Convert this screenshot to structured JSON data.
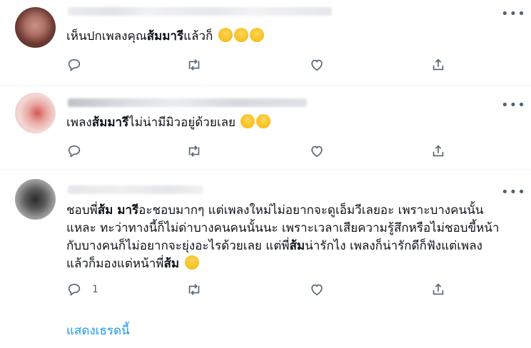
{
  "tweets": [
    {
      "text_plain1": "เห็นปกเพลงคุณ",
      "text_bold1": "ส้มมารี",
      "text_plain2": "แล้วก็",
      "emojis": [
        "crying-face-emoji",
        "crying-face-emoji",
        "crying-face-emoji"
      ],
      "reply_count": "",
      "retweet_count": "",
      "like_count": ""
    },
    {
      "text_plain1": "เพลง",
      "text_bold1": "ส้มมารี",
      "text_plain2": "ไม่น่ามีมิวอยู่ด้วยเลย",
      "emojis": [
        "unamused-face-emoji",
        "unamused-face-emoji"
      ],
      "reply_count": "",
      "retweet_count": "",
      "like_count": ""
    },
    {
      "line1_plain1": "ชอบพี่",
      "line1_bold1": "ส้ม มารี",
      "line1_plain2": "อะชอบมากๆ แต่เพลงใหม่ไม่อยากจะดูเอ็มวีเลยอะ เพราะบางคนนั้น",
      "line2": "แหละ ทะว่าทางนี้ก็ไม่ด่าบางคนคนนั้นนะ เพราะเวลาเสียความรู้สึกหรือไม่ชอบขี้หน้า",
      "line3_plain1": "กับบางคนก็ไม่อยากจะยุ่งอะไรด้วยเลย แต่พี่",
      "line3_bold1": "ส้ม",
      "line3_plain2": "น่ารักไง เพลงก็น่ารักดีก็ฟังแต่เพลง",
      "line4_plain1": "แล้วก็มองแต่หน้าพี่",
      "line4_bold1": "ส้ม",
      "emojis": [
        "drooling-face-emoji"
      ],
      "reply_count": "1",
      "retweet_count": "",
      "like_count": ""
    }
  ],
  "show_thread": "แสดงเธรดนี้",
  "colors": {
    "icon": "#536471",
    "link": "#1d9bf0",
    "divider": "#eff3f4"
  }
}
